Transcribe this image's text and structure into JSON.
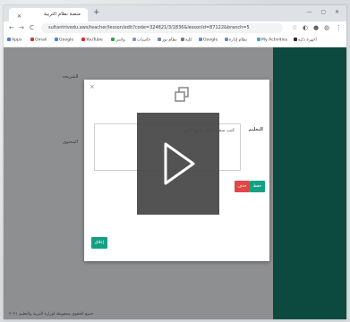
{
  "browser": {
    "tab_label": "منصة نظام التربية",
    "tab_close": "✕",
    "new_tab": "+",
    "window_controls": "— ▢ ✕",
    "nav_back": "←",
    "nav_forward": "→",
    "nav_reload": "C",
    "address": "sultantrivedu.aws/teacher/lesson/edit?code=324821/3/1836&lessonId=87122&branch=5",
    "bookmarks": [
      {
        "label": "Apps",
        "color": "#4a7ec2"
      },
      {
        "label": "Gmail",
        "color": "#c73a2c"
      },
      {
        "label": "Google",
        "color": "#4285f4"
      },
      {
        "label": "YouTube",
        "color": "#e22c2c"
      },
      {
        "label": "واتس",
        "color": "#2ea84a"
      },
      {
        "label": "حاسبات",
        "color": "#7a9ad1"
      },
      {
        "label": "نظام نور",
        "color": "#6f89b7"
      },
      {
        "label": "كلية",
        "color": "#7d7d7d"
      },
      {
        "label": "Google",
        "color": "#5b8ad6"
      },
      {
        "label": "نظام إدارة",
        "color": "#6d8fbf"
      },
      {
        "label": "My Activities",
        "color": "#4aa0e0"
      },
      {
        "label": "أجهزة ذكية",
        "color": "#2a2a2a"
      }
    ]
  },
  "page": {
    "side_text_1": "الشريحة",
    "side_text_2": "المحتوى",
    "footer": "جميع الحقوق محفوظة لوزارة التربية والتعليم ٢٠٢١"
  },
  "modal": {
    "close": "×",
    "label": "التعليم",
    "textarea_value": "كتب سطر داخل مربع النص",
    "save_label": "حفظ",
    "delete_label": "حذف",
    "bottom_button_label": "إغلاق"
  },
  "video": {
    "play_icon": "play-icon"
  }
}
